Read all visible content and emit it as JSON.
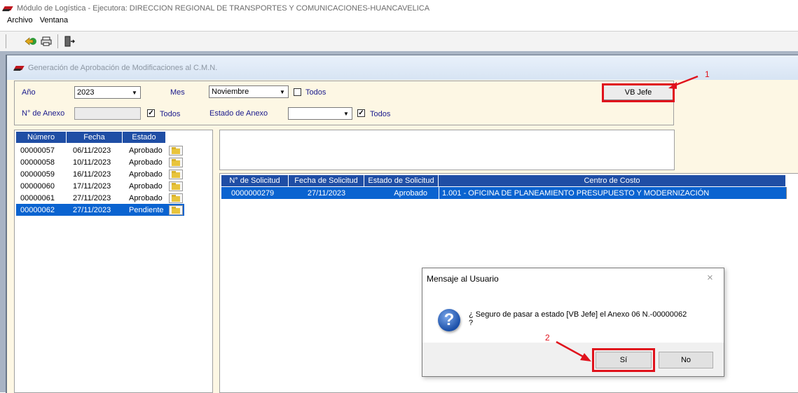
{
  "window": {
    "title": "Módulo de Logística - Ejecutora: DIRECCION REGIONAL DE TRANSPORTES Y COMUNICACIONES-HUANCAVELICA"
  },
  "menu": {
    "items": [
      "Archivo",
      "Ventana"
    ]
  },
  "toolbar": {
    "icons": [
      "back-arrow-icon",
      "printer-icon",
      "exit-door-icon"
    ]
  },
  "child_window": {
    "title": "Generación de Aprobación de Modificaciones al C.M.N."
  },
  "filters": {
    "anio_label": "Año",
    "anio_value": "2023",
    "mes_label": "Mes",
    "mes_value": "Noviembre",
    "mes_todos_label": "Todos",
    "mes_todos_checked": false,
    "anexo_label": "N° de Anexo",
    "anexo_value": "",
    "anexo_todos_label": "Todos",
    "anexo_todos_checked": true,
    "estado_label": "Estado de Anexo",
    "estado_value": "",
    "estado_todos_label": "Todos",
    "estado_todos_checked": true,
    "vb_button": "VB Jefe"
  },
  "left_grid": {
    "headers": [
      "Número",
      "Fecha",
      "Estado"
    ],
    "rows": [
      {
        "numero": "00000057",
        "fecha": "06/11/2023",
        "estado": "Aprobado"
      },
      {
        "numero": "00000058",
        "fecha": "10/11/2023",
        "estado": "Aprobado"
      },
      {
        "numero": "00000059",
        "fecha": "16/11/2023",
        "estado": "Aprobado"
      },
      {
        "numero": "00000060",
        "fecha": "17/11/2023",
        "estado": "Aprobado"
      },
      {
        "numero": "00000061",
        "fecha": "27/11/2023",
        "estado": "Aprobado"
      },
      {
        "numero": "00000062",
        "fecha": "27/11/2023",
        "estado": "Pendiente"
      }
    ],
    "selected_index": 5
  },
  "right_grid": {
    "headers": [
      "N° de Solicitud",
      "Fecha de Solicitud",
      "Estado de Solicitud",
      "Centro de Costo"
    ],
    "rows": [
      {
        "solicitud": "0000000279",
        "fecha": "27/11/2023",
        "estado": "Aprobado",
        "centro": "1.001 - OFICINA DE PLANEAMIENTO PRESUPUESTO Y MODERNIZACIÓN"
      }
    ]
  },
  "dialog": {
    "title": "Mensaje al Usuario",
    "close_glyph": "×",
    "message": "¿ Seguro de pasar a estado [VB Jefe] el Anexo 06 N.-00000062",
    "message_line2": "?",
    "yes_label": "Sí",
    "no_label": "No"
  },
  "annotations": {
    "marker_1": "1",
    "marker_2": "2",
    "color": "#e0121c"
  },
  "colors": {
    "header_blue": "#1f4ea5",
    "selection_blue": "#0a63d0",
    "panel_bg": "#fdf7e4"
  }
}
